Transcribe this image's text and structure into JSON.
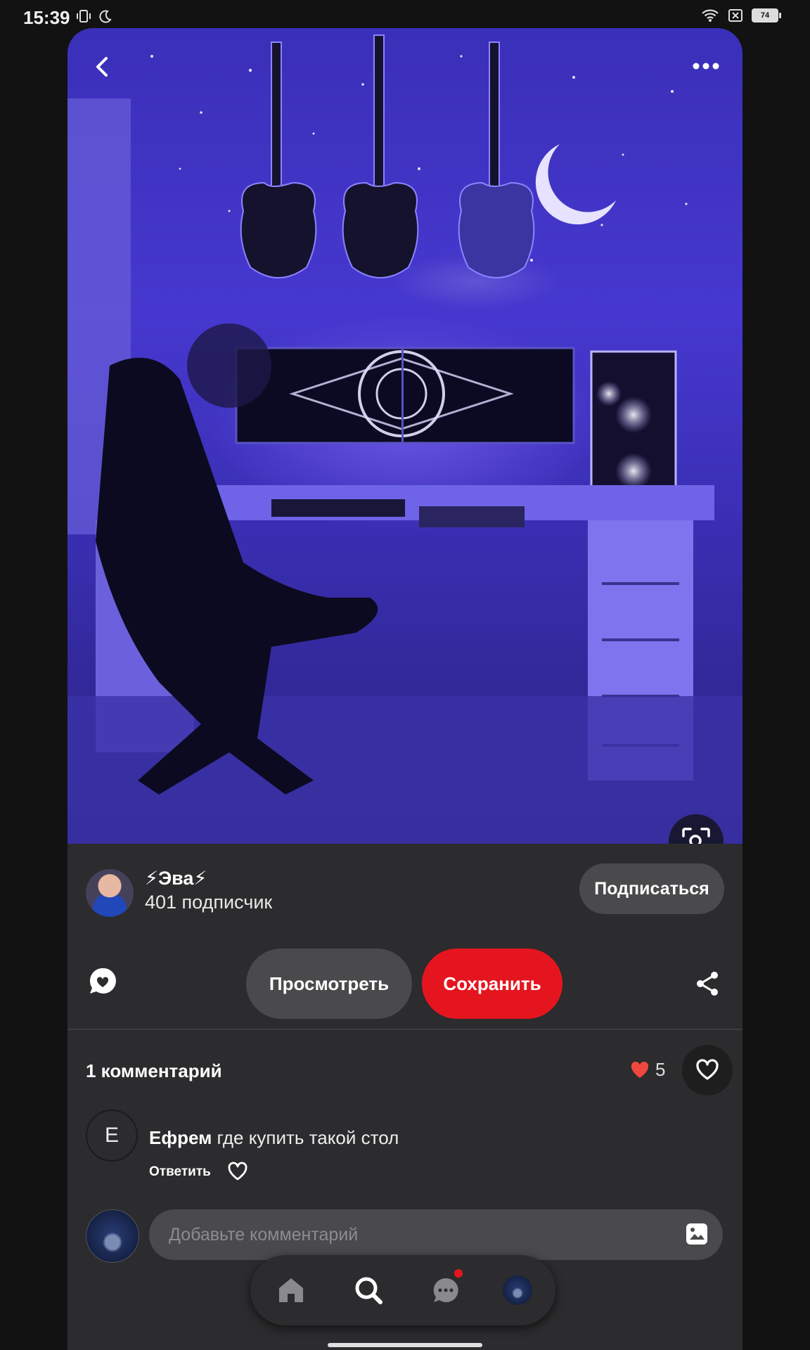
{
  "status_bar": {
    "time": "15:39",
    "battery": "74",
    "icons": [
      "vibrate-icon",
      "moon-icon",
      "wifi-icon",
      "sim-icon",
      "battery-icon"
    ]
  },
  "pin": {
    "image_description": "",
    "author": {
      "name": "⚡Эва⚡",
      "followers": "401 подписчик",
      "follow_label": "Подписаться"
    },
    "actions": {
      "view_label": "Просмотреть",
      "save_label": "Сохранить"
    }
  },
  "comments": {
    "header": "1 комментарий",
    "reaction_count": "5",
    "items": [
      {
        "avatar_letter": "Е",
        "author": "Ефрем",
        "text": " где купить такой стол",
        "reply_label": "Ответить"
      }
    ],
    "input_placeholder": "Добавьте комментарий"
  },
  "colors": {
    "accent": "#e51520",
    "background": "#121213",
    "panel": "#2c2b2d",
    "pill": "#4a4a4c"
  },
  "nav": {
    "items": [
      "home-icon",
      "search-icon",
      "chat-icon",
      "profile-avatar"
    ]
  }
}
